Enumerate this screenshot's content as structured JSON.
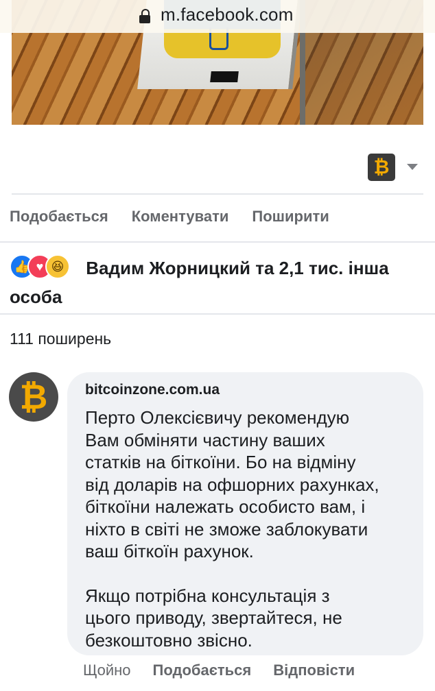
{
  "browser": {
    "url": "m.facebook.com",
    "lock_icon": "lock-icon"
  },
  "post": {
    "reaction_picker_icon": "bitcoin-icon",
    "actions": {
      "like": "Подобається",
      "comment": "Коментувати",
      "share": "Поширити"
    },
    "reactions_summary": "Вадим Жорницкий та 2,1 тис. інша особа",
    "reaction_icons": [
      "like-icon",
      "love-icon",
      "haha-icon"
    ],
    "shares": "111 поширень"
  },
  "comment": {
    "author": "bitcoinzone.com.ua",
    "avatar_icon": "bitcoin-icon",
    "paragraph1": "Перто Олексієвичу рекомендую\nВам обміняти частину ваших\nстатків на біткоїни. Бо на відміну\nвід доларів на офшорних рахунках,\nбіткоїни належать особисто вам, і\nніхто в світі не зможе заблокувати\nваш біткоїн рахунок.",
    "paragraph2": "Якщо потрібна консультація з\nцього приводу, звертайтеся, не\nбезкоштовно звісно.",
    "time": "Щойно",
    "like": "Подобається",
    "reply": "Відповісти"
  },
  "colors": {
    "like_blue": "#1877f2",
    "love_red": "#f33e58",
    "haha_yellow": "#f7c234",
    "bitcoin_orange": "#f2a900",
    "muted_text": "#65676b",
    "bubble_bg": "#f0f2f5"
  }
}
